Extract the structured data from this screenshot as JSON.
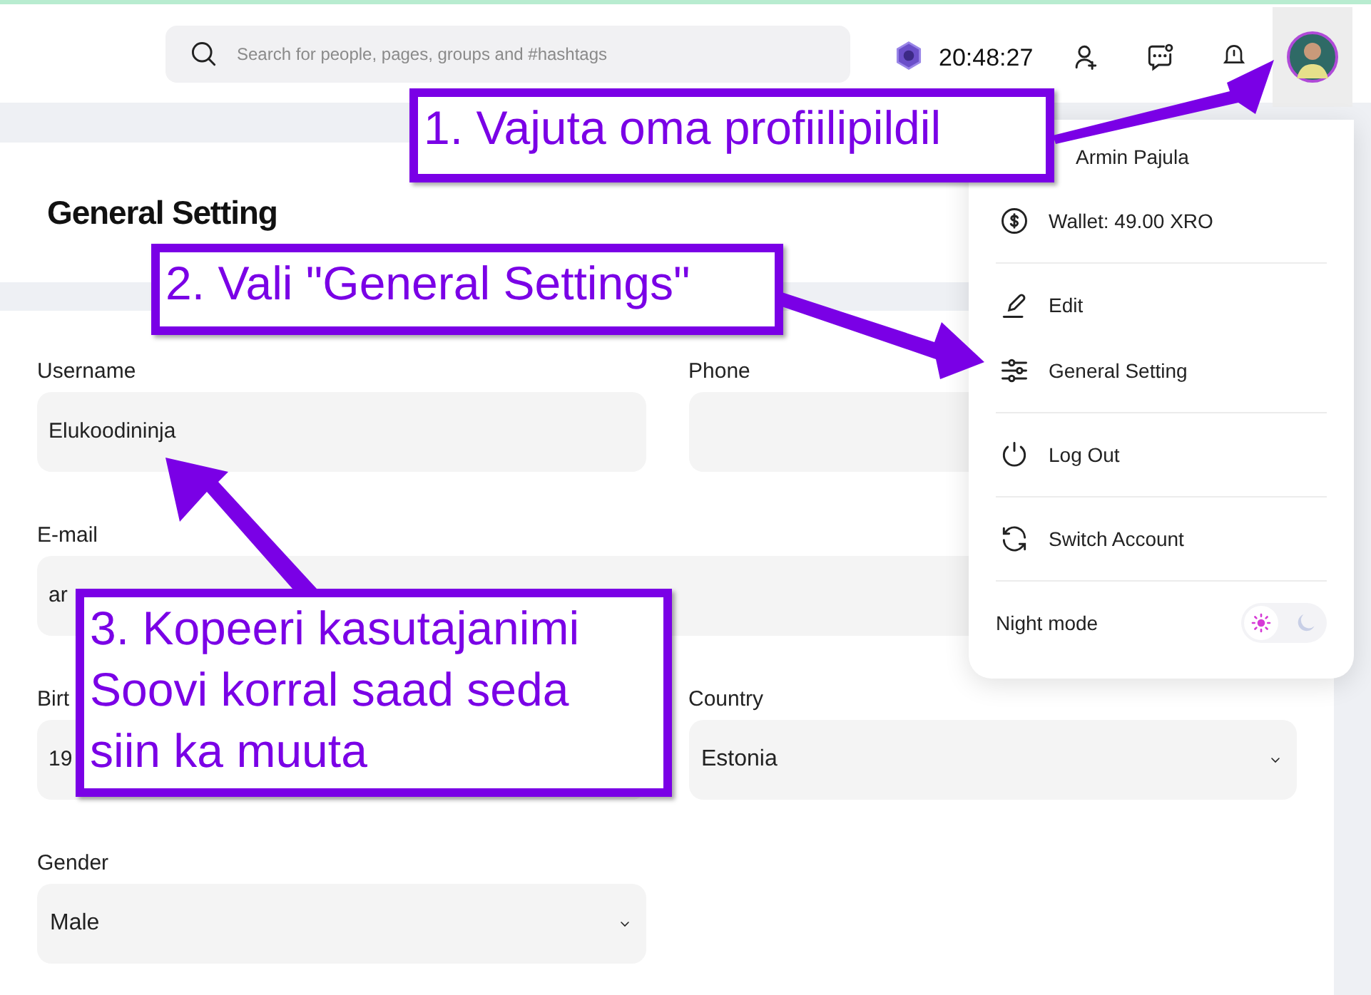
{
  "search": {
    "placeholder": "Search for people, pages, groups and #hashtags"
  },
  "clock": "20:48:27",
  "page_title": "General Setting",
  "form": {
    "fields": [
      {
        "label": "Username",
        "value": "Elukoodininja",
        "kind": "input",
        "wide": false
      },
      {
        "label": "Phone",
        "kind": "input",
        "wide": false
      },
      {
        "label": "E-mail",
        "value": "ar",
        "kind": "input",
        "wide": true
      },
      {
        "label": "Birt",
        "value": "19",
        "kind": "input",
        "wide": false
      },
      {
        "label": "Country",
        "value": "Estonia",
        "kind": "select",
        "wide": false
      },
      {
        "label": "Gender",
        "value": "Male",
        "kind": "select",
        "wide": false
      }
    ]
  },
  "profile_menu": {
    "sections": [
      [
        {
          "label": "Armin Pajula",
          "kind": "name"
        },
        {
          "label": "Wallet: 49.00 XRO",
          "kind": "wallet"
        }
      ],
      [
        {
          "label": "Edit",
          "kind": "edit"
        },
        {
          "label": "General Setting",
          "kind": "settings"
        }
      ],
      [
        {
          "label": "Log Out",
          "kind": "logout"
        }
      ],
      [
        {
          "label": "Switch Account",
          "kind": "switch"
        }
      ]
    ],
    "night_mode": {
      "label": "Night mode",
      "on": false
    }
  },
  "annotations": [
    {
      "text": "1. Vajuta oma profiilipildil"
    },
    {
      "text": "2. Vali \"General Settings\""
    },
    {
      "text": "3. Kopeeri kasutajanimi Soovi korral saad seda siin ka muuta"
    }
  ]
}
